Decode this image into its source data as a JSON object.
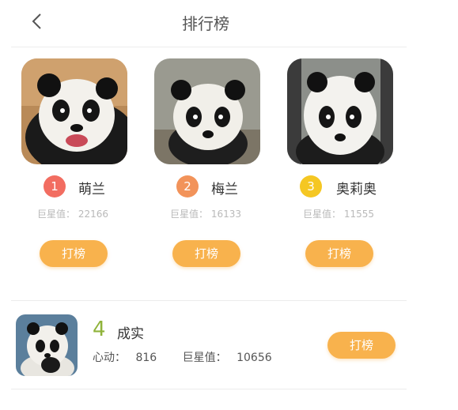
{
  "header": {
    "title": "排行榜",
    "back_icon": "chevron-left-icon"
  },
  "colors": {
    "button": "#f8b24d",
    "rank1": "#f26d61",
    "rank2": "#f2935a",
    "rank3": "#f5c723",
    "rank4": "#8fb33a"
  },
  "top3": [
    {
      "rank": "1",
      "name": "萌兰",
      "star_label": "巨星值：",
      "star_value": "22166",
      "button": "打榜"
    },
    {
      "rank": "2",
      "name": "梅兰",
      "star_label": "巨星值：",
      "star_value": "16133",
      "button": "打榜"
    },
    {
      "rank": "3",
      "name": "奥莉奥",
      "star_label": "巨星值：",
      "star_value": "11555",
      "button": "打榜"
    }
  ],
  "list": [
    {
      "rank": "4",
      "name": "成实",
      "heart_label": "心动：",
      "heart_value": "816",
      "star_label": "巨星值：",
      "star_value": "10656",
      "button": "打榜"
    }
  ]
}
